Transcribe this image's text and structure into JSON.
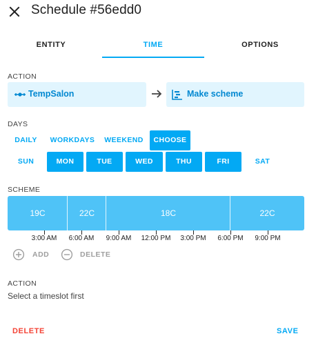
{
  "dialog": {
    "title": "Schedule #56edd0",
    "close_icon": "close-icon"
  },
  "tabs": [
    {
      "label": "ENTITY"
    },
    {
      "label": "TIME",
      "active": true
    },
    {
      "label": "OPTIONS"
    }
  ],
  "action": {
    "label": "ACTION",
    "entity": {
      "icon": "radiator-icon",
      "text": "TempSalon"
    },
    "arrow_icon": "arrow-right-icon",
    "service": {
      "icon": "chart-timeline-icon",
      "text": "Make scheme"
    }
  },
  "days": {
    "label": "DAYS",
    "modes": [
      {
        "label": "DAILY",
        "selected": false
      },
      {
        "label": "WORKDAYS",
        "selected": false
      },
      {
        "label": "WEEKEND",
        "selected": false
      },
      {
        "label": "CHOOSE",
        "selected": true
      }
    ],
    "weekdays": [
      {
        "label": "SUN",
        "selected": false
      },
      {
        "label": "MON",
        "selected": true
      },
      {
        "label": "TUE",
        "selected": true
      },
      {
        "label": "WED",
        "selected": true
      },
      {
        "label": "THU",
        "selected": true
      },
      {
        "label": "FRI",
        "selected": true
      },
      {
        "label": "SAT",
        "selected": false
      }
    ]
  },
  "scheme": {
    "label": "SCHEME",
    "slots": [
      {
        "value": "19C"
      },
      {
        "value": "22C"
      },
      {
        "value": "18C"
      },
      {
        "value": "22C"
      }
    ],
    "time_labels": [
      "3:00 AM",
      "6:00 AM",
      "9:00 AM",
      "12:00 PM",
      "3:00 PM",
      "6:00 PM",
      "9:00 PM"
    ],
    "add_label": "ADD",
    "delete_label": "DELETE"
  },
  "slot_action": {
    "label": "ACTION",
    "hint": "Select a timeslot first"
  },
  "footer": {
    "delete_label": "DELETE",
    "save_label": "SAVE"
  },
  "colors": {
    "accent": "#03a9f4",
    "slot": "#4fc3f7",
    "action_bg": "#e1f5fe",
    "danger": "#f44336",
    "disabled": "#9e9e9e"
  }
}
